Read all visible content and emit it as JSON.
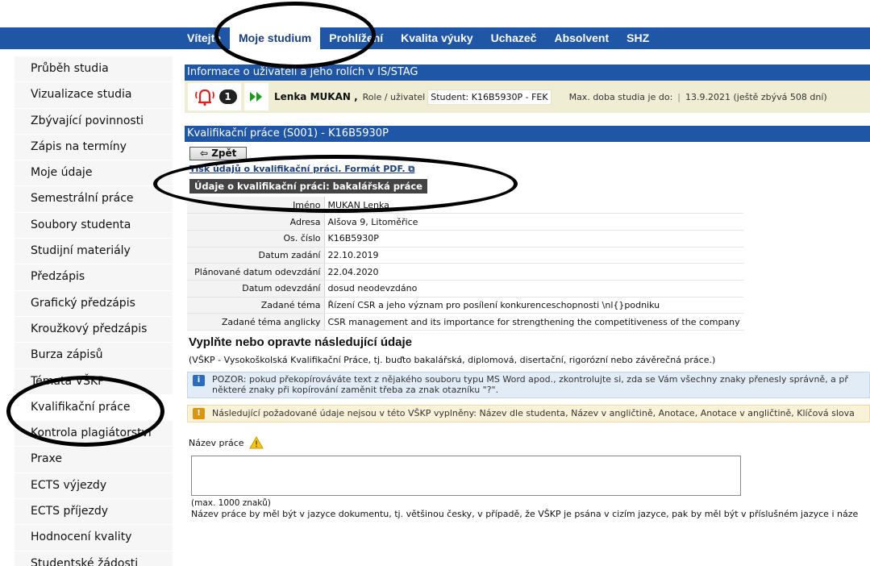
{
  "topnav": [
    "Vítejte",
    "Moje studium",
    "Prohlížení",
    "Kvalita výuky",
    "Uchazeč",
    "Absolvent",
    "SHZ"
  ],
  "topnav_active": "Moje studium",
  "sidebar": {
    "items": [
      "Průběh studia",
      "Vizualizace studia",
      "Zbývající povinnosti",
      "Zápis na termíny",
      "Moje údaje",
      "Semestrální práce",
      "Soubory studenta",
      "Studijní materiály",
      "Předzápis",
      "Grafický předzápis",
      "Kroužkový předzápis",
      "Burza zápisů",
      "Témata VŠKP",
      "Kvalifikační práce",
      "Kontrola plagiátorství",
      "Praxe",
      "ECTS výjezdy",
      "ECTS příjezdy",
      "Hodnocení kvality",
      "Studentské žádosti"
    ],
    "active": "Kvalifikační práce"
  },
  "userinfo": {
    "title": "Informace o uživateli a jeho rolích v IS/STAG",
    "notif_count": "1",
    "name": "Lenka MUKAN ,",
    "role_label": "Role / uživatel",
    "role_value": "Student: K16B5930P - FEK",
    "max_label": "Max. doba studia je do:",
    "max_value": "13.9.2021 (ještě zbývá 508 dní)"
  },
  "thesis": {
    "header": "Kvalifikační práce (S001) - K16B5930P",
    "back_label": "Zpět",
    "pdf_link": "Tisk údajů o kvalifikační práci. Formát PDF.",
    "subheader": "Údaje o kvalifikační práci: bakalářská práce",
    "rows": [
      {
        "k": "Jméno",
        "v": "MUKAN Lenka"
      },
      {
        "k": "Adresa",
        "v": "Alšova 9, Litoměřice"
      },
      {
        "k": "Os. číslo",
        "v": "K16B5930P"
      },
      {
        "k": "Datum zadání",
        "v": "22.10.2019"
      },
      {
        "k": "Plánované datum odevzdání",
        "v": "22.04.2020"
      },
      {
        "k": "Datum odevzdání",
        "v": "dosud neodevzdáno"
      },
      {
        "k": "Zadané téma",
        "v": "Řízení CSR a jeho význam pro posílení konkurenceschopnosti \\nl{}podniku"
      },
      {
        "k": "Zadané téma anglicky",
        "v": "CSR management and its importance for strengthening the competitiveness of the company"
      }
    ]
  },
  "form": {
    "heading": "Vyplňte nebo opravte následující údaje",
    "note": "(VŠKP - Vysokoškolská Kvalifikační Práce, tj. buďto bakalářská, diplomová, disertační, rigorózní nebo závěrečná práce.)",
    "info_line1": "POZOR: pokud překopírováváte text z nějakého souboru typu MS Word apod., zkontrolujte si, zda se Vám všechny znaky přenesly správně, a př",
    "info_line2": "některé znaky při kopírování zaměnit třeba za znak otazníku \"?\".",
    "warning": "Následující požadované údaje nejsou v této VŠKP vyplněny: Název dle studenta, Název v angličtině, Anotace, Anotace v angličtině, Klíčová slova",
    "field_label": "Název práce",
    "max_chars": "(max. 1000 znaků)",
    "hint": "Název práce by měl být v jazyce dokumentu, tj. většinou česky, v případě, že VŠKP je psána v cizím jazyce, pak by měl být v příslušném jazyce i náze"
  },
  "colors": {
    "nav": "#1f56a6",
    "userbar": "#efeed4",
    "annotation": "#000000"
  }
}
